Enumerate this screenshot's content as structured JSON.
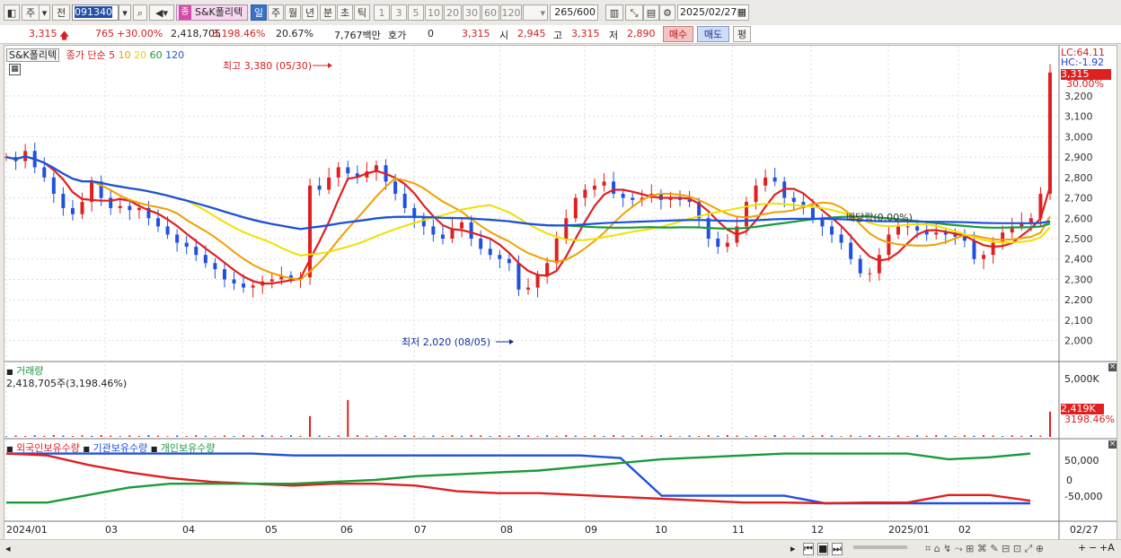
{
  "toolbar": {
    "period_type": "주",
    "prev": "전",
    "code": "091340",
    "stock_name": "S&K폴리텍",
    "name_badge": "종",
    "period_buttons": [
      "일",
      "주",
      "월",
      "년",
      "분",
      "초",
      "틱"
    ],
    "interval_buttons": [
      "1",
      "3",
      "5",
      "10",
      "20",
      "30",
      "60",
      "120"
    ],
    "count": "265",
    "count_total": "/600",
    "date": "2025/02/27"
  },
  "quote": {
    "price": "3,315",
    "change": "765",
    "change_pct": "+30.00%",
    "volume": "2,418,705",
    "volume_pct": "3,198.46%",
    "turnover": "20.67%",
    "amount": "7,767백만",
    "hoga_label": "호가",
    "hoga_value": "0",
    "hoga_price": "3,315",
    "open_label": "시",
    "open": "2,945",
    "high_label": "고",
    "high": "3,315",
    "low_label": "저",
    "low": "2,890",
    "buy_label": "매수",
    "sell_label": "매도",
    "flat_label": "평"
  },
  "legend": {
    "name": "S&K폴리텍",
    "type": "종가 단순",
    "ma": [
      {
        "label": "5",
        "color": "#e02020"
      },
      {
        "label": "10",
        "color": "#f0a000"
      },
      {
        "label": "20",
        "color": "#f0e000"
      },
      {
        "label": "60",
        "color": "#1a9a3a"
      },
      {
        "label": "120",
        "color": "#2050e0"
      }
    ]
  },
  "annotations": {
    "high": "최고 3,380 (05/30)",
    "low": "최저 2,020 (08/05)",
    "dividend": "배당락(0.00%)"
  },
  "right_axis": {
    "lc": "LC:64.11",
    "hc": "HC:-1.92",
    "current": "3,315",
    "current_pct": "30.00%",
    "price_ticks": [
      "3,200",
      "3,100",
      "3,000",
      "2,900",
      "2,800",
      "2,700",
      "2,600",
      "2,500",
      "2,400",
      "2,300",
      "2,200",
      "2,100",
      "2,000"
    ],
    "volume_ticks": [
      "5,000K"
    ],
    "volume_current": "2,419K",
    "volume_pct": "3198.46%",
    "holding_ticks": [
      "50,000",
      "0",
      "-50,000"
    ]
  },
  "volume_panel": {
    "title": "거래량",
    "value": "2,418,705주(3,198.46%)"
  },
  "holding_panel": {
    "items": [
      {
        "label": "외국인보유수량",
        "color": "#e02020"
      },
      {
        "label": "기관보유수량",
        "color": "#2050e0"
      },
      {
        "label": "개인보유수량",
        "color": "#1a9a3a"
      }
    ]
  },
  "x_axis": {
    "labels": [
      "2024/01",
      "03",
      "04",
      "05",
      "06",
      "07",
      "08",
      "09",
      "10",
      "11",
      "12",
      "2025/01",
      "02"
    ],
    "right": "02/27"
  },
  "chart_data": {
    "type": "candlestick",
    "price_range": [
      2000,
      3380
    ],
    "close_series": [
      2900,
      2880,
      2930,
      2850,
      2800,
      2720,
      2650,
      2620,
      2680,
      2780,
      2700,
      2650,
      2660,
      2640,
      2650,
      2600,
      2560,
      2520,
      2480,
      2460,
      2420,
      2380,
      2350,
      2300,
      2280,
      2260,
      2270,
      2290,
      2300,
      2320,
      2300,
      2310,
      2760,
      2740,
      2800,
      2850,
      2820,
      2800,
      2830,
      2860,
      2780,
      2720,
      2650,
      2600,
      2560,
      2520,
      2500,
      2550,
      2580,
      2500,
      2450,
      2420,
      2400,
      2380,
      2250,
      2260,
      2320,
      2380,
      2500,
      2600,
      2700,
      2740,
      2760,
      2780,
      2720,
      2700,
      2690,
      2700,
      2720,
      2690,
      2700,
      2690,
      2680,
      2600,
      2500,
      2460,
      2480,
      2560,
      2680,
      2760,
      2800,
      2780,
      2700,
      2680,
      2650,
      2600,
      2560,
      2520,
      2480,
      2400,
      2330,
      2330,
      2420,
      2520,
      2560,
      2560,
      2540,
      2520,
      2530,
      2520,
      2510,
      2490,
      2400,
      2420,
      2480,
      2530,
      2560,
      2580,
      2600,
      2720,
      3315
    ],
    "ma_values_at_end": {
      "ma5": 2720,
      "ma10": 2600,
      "ma20": 2560,
      "ma60": 2520,
      "ma120": 2590
    },
    "volume_spikes_k": {
      "05/27": 2000,
      "05/30": 3550,
      "02/27": 2419
    },
    "holding_ticks": [
      50000,
      0,
      -50000
    ]
  }
}
